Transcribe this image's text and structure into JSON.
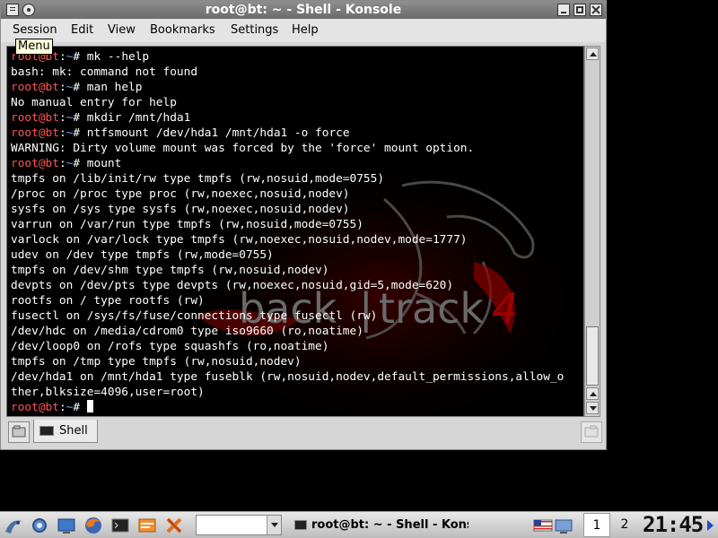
{
  "window": {
    "title": "root@bt: ~ - Shell - Konsole",
    "tooltip": "Menu",
    "menu": [
      "Session",
      "Edit",
      "View",
      "Bookmarks",
      "Settings",
      "Help"
    ]
  },
  "wallpaper": {
    "text_left": "back",
    "text_sep": "|",
    "text_right": "track",
    "text_num": "4"
  },
  "terminal": {
    "prompt_user": "root@bt",
    "prompt_path": "~",
    "lines": [
      {
        "type": "cmd",
        "text": "mk --help"
      },
      {
        "type": "out",
        "text": "bash: mk: command not found"
      },
      {
        "type": "cmd",
        "text": "man help"
      },
      {
        "type": "out",
        "text": "No manual entry for help"
      },
      {
        "type": "cmd",
        "text": "mkdir /mnt/hda1"
      },
      {
        "type": "cmd",
        "text": "ntfsmount /dev/hda1 /mnt/hda1 -o force"
      },
      {
        "type": "out",
        "text": "WARNING: Dirty volume mount was forced by the 'force' mount option."
      },
      {
        "type": "cmd",
        "text": "mount"
      },
      {
        "type": "out",
        "text": "tmpfs on /lib/init/rw type tmpfs (rw,nosuid,mode=0755)"
      },
      {
        "type": "out",
        "text": "/proc on /proc type proc (rw,noexec,nosuid,nodev)"
      },
      {
        "type": "out",
        "text": "sysfs on /sys type sysfs (rw,noexec,nosuid,nodev)"
      },
      {
        "type": "out",
        "text": "varrun on /var/run type tmpfs (rw,nosuid,mode=0755)"
      },
      {
        "type": "out",
        "text": "varlock on /var/lock type tmpfs (rw,noexec,nosuid,nodev,mode=1777)"
      },
      {
        "type": "out",
        "text": "udev on /dev type tmpfs (rw,mode=0755)"
      },
      {
        "type": "out",
        "text": "tmpfs on /dev/shm type tmpfs (rw,nosuid,nodev)"
      },
      {
        "type": "out",
        "text": "devpts on /dev/pts type devpts (rw,noexec,nosuid,gid=5,mode=620)"
      },
      {
        "type": "out",
        "text": "rootfs on / type rootfs (rw)"
      },
      {
        "type": "out",
        "text": "fusectl on /sys/fs/fuse/connections type fusectl (rw)"
      },
      {
        "type": "out",
        "text": "/dev/hdc on /media/cdrom0 type iso9660 (ro,noatime)"
      },
      {
        "type": "out",
        "text": "/dev/loop0 on /rofs type squashfs (ro,noatime)"
      },
      {
        "type": "out",
        "text": "tmpfs on /tmp type tmpfs (rw,nosuid,nodev)"
      },
      {
        "type": "out",
        "text": "/dev/hda1 on /mnt/hda1 type fuseblk (rw,nosuid,nodev,default_permissions,allow_o"
      },
      {
        "type": "out",
        "text": "ther,blksize=4096,user=root)"
      },
      {
        "type": "prompt",
        "text": ""
      }
    ]
  },
  "tabs": [
    {
      "label": "Shell"
    }
  ],
  "taskbar": {
    "task_label": "root@bt: ~ - Shell - Konsole",
    "desktops": [
      "1",
      "2"
    ],
    "clock": "21:45"
  },
  "colors": {
    "prompt_user": "#ff5454",
    "prompt_path": "#6f9fff",
    "accent": "#1a4fc6"
  }
}
